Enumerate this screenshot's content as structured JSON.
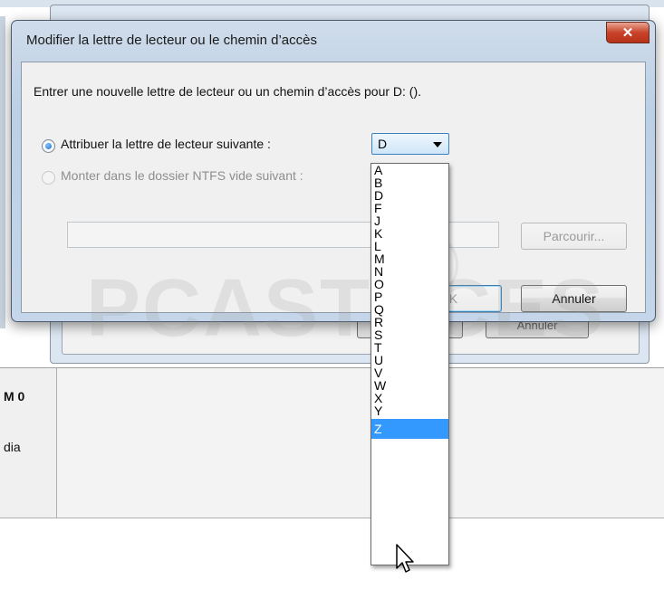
{
  "background": {
    "cancel_label": "Annuler",
    "disk_label": "M 0",
    "disk_sublabel": "dia"
  },
  "dialog": {
    "title": "Modifier la lettre de lecteur ou le chemin d’accès",
    "close_icon": "x-close-icon",
    "instruction": "Entrer une nouvelle lettre de lecteur ou un chemin d’accès pour D: ().",
    "option_assign": "Attribuer la lettre de lecteur suivante :",
    "option_mount": "Monter dans le dossier NTFS vide suivant :",
    "selected_letter": "D",
    "path_value": "",
    "browse_label": "Parcourir...",
    "ok_label": "OK",
    "cancel_label": "Annuler"
  },
  "dropdown": {
    "options": [
      "A",
      "B",
      "D",
      "F",
      "J",
      "K",
      "L",
      "M",
      "N",
      "O",
      "P",
      "Q",
      "R",
      "S",
      "T",
      "U",
      "V",
      "W",
      "X",
      "Y",
      "Z"
    ],
    "highlighted": "Z"
  },
  "watermark": "PCASTUCES"
}
